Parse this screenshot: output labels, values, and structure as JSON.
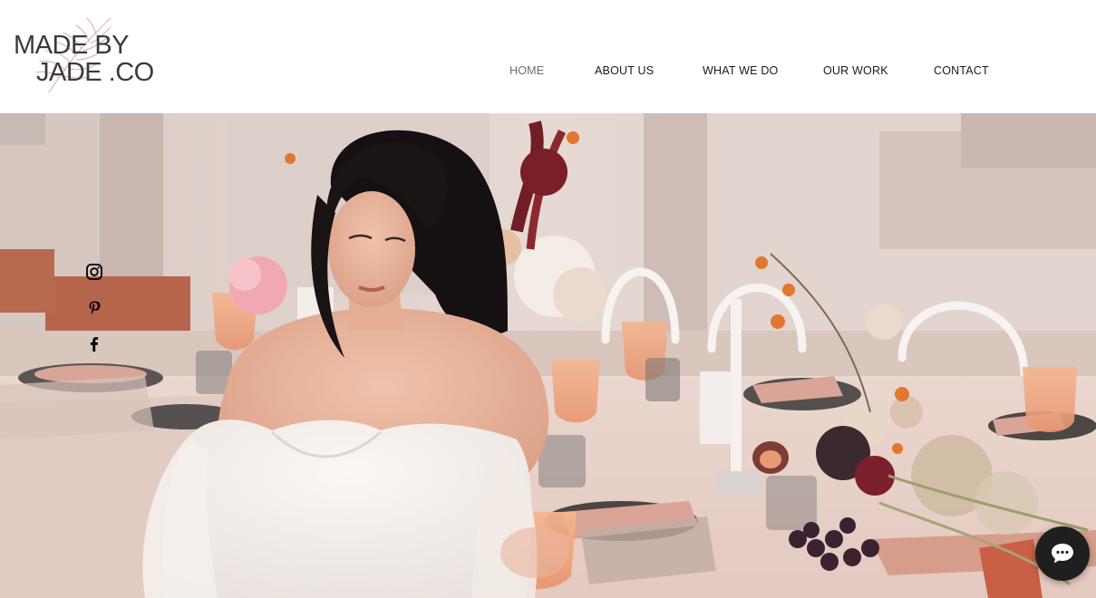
{
  "brand": {
    "line1": "MADE BY",
    "line2": "JADE .CO",
    "leaf_icon": "leaf-sketch-icon"
  },
  "nav": {
    "items": [
      {
        "label": "HOME",
        "active": true
      },
      {
        "label": "ABOUT US",
        "active": false
      },
      {
        "label": "WHAT WE DO",
        "active": false
      },
      {
        "label": "OUR WORK",
        "active": false
      },
      {
        "label": "CONTACT",
        "active": false
      }
    ],
    "active_color": "#6f6f6f",
    "text_color": "#1a1a1a"
  },
  "hero": {
    "image": "bride-at-wedding-table-photo"
  },
  "social": {
    "icons": [
      "instagram-icon",
      "pinterest-icon",
      "facebook-icon"
    ],
    "color": "#000000"
  },
  "chat": {
    "icon": "chat-bubble-icon",
    "background": "#1f1f1f"
  }
}
